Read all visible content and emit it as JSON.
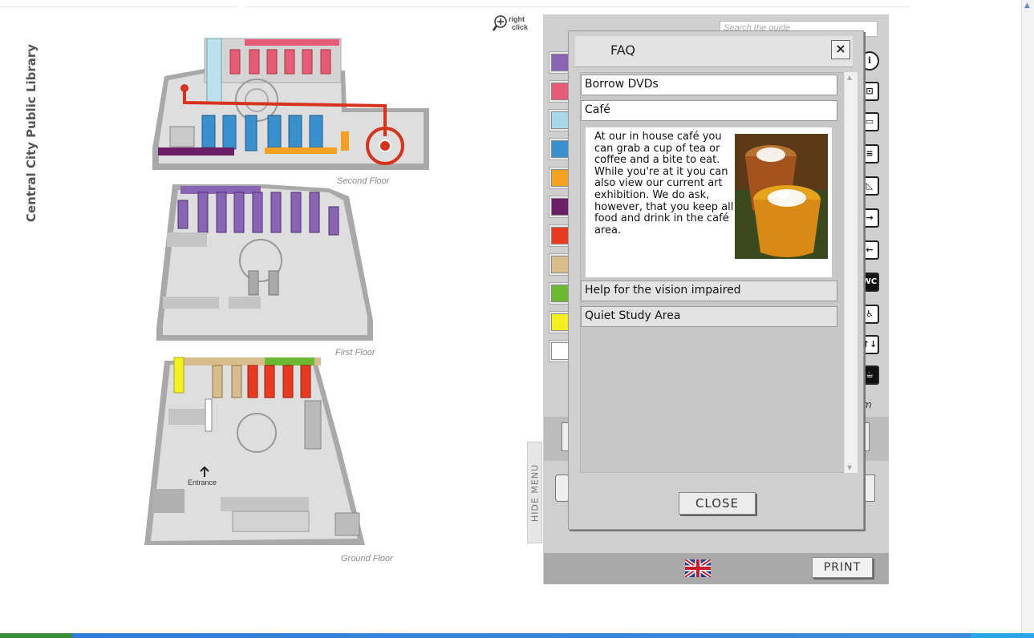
{
  "library_title": "Central City Public Library",
  "zoom_hint": {
    "line1": "right",
    "line2": "click",
    "icon": "zoom-in-icon"
  },
  "floors": [
    {
      "label": "Second Floor"
    },
    {
      "label": "First Floor"
    },
    {
      "label": "Ground Floor"
    }
  ],
  "entrance_label": "Entrance",
  "search": {
    "placeholder": "Search the guide"
  },
  "legend_colors": [
    "#8a64b4",
    "#e65c78",
    "#a8d8e8",
    "#3a90cc",
    "#f4a020",
    "#6a1e66",
    "#e83a1e",
    "#d8bc8c",
    "#6cb830",
    "#f4f020",
    "#ffffff"
  ],
  "right_icons": [
    "info-icon",
    "photocopier-icon",
    "computer-icon",
    "catalog-icon",
    "printer-icon",
    "entrance-icon",
    "exit-icon",
    "toilet-icon",
    "accessible-toilet-icon",
    "elevator-icon",
    "cafe-icon"
  ],
  "right_icon_text": {
    "toilet": "WC",
    "elevator": "↑↓",
    "accessible": "♿"
  },
  "hide_menu_label": "HIDE  MENU",
  "faq": {
    "title": "FAQ",
    "close_x": "×",
    "items": [
      {
        "label": "Borrow DVDs"
      },
      {
        "label": "Café"
      },
      {
        "label": "Help for the vision impaired"
      },
      {
        "label": "Quiet Study Area"
      }
    ],
    "expanded_answer": "At our in house café you can grab a cup of tea or coffee and a bite to eat. While you're at it you can also view our current art exhibition. We do ask, however, that you keep all food and drink in the café area.",
    "close_label": "CLOSE"
  },
  "print_label": "PRINT",
  "language_flag": "uk-flag-icon",
  "partial_text_m": "m"
}
